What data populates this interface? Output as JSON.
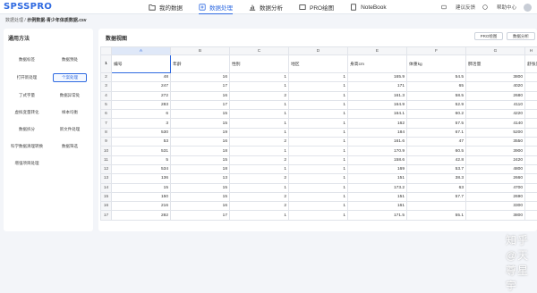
{
  "app": {
    "logo": "SPSSPRO"
  },
  "nav": [
    {
      "label": "我的数据",
      "icon": "folder-icon"
    },
    {
      "label": "数据处理",
      "icon": "data-process-icon",
      "active": true
    },
    {
      "label": "数据分析",
      "icon": "chart-icon"
    },
    {
      "label": "PRO绘图",
      "icon": "pro-draw-icon"
    },
    {
      "label": "NoteBook",
      "icon": "notebook-icon"
    }
  ],
  "top_right": {
    "feedback": "建议反馈",
    "help": "帮助中心"
  },
  "breadcrumb": {
    "root": "数据处理",
    "sep": " / ",
    "file": "示例数据-青少年体质数据.csv"
  },
  "left_panel": {
    "title": "通用方法",
    "methods": [
      "数据标签",
      "数据预处",
      "打开新处理",
      "个案处理",
      "丁式字量",
      "数据异常处",
      "虚拟变量转化",
      "样本均衡",
      "数据拆分",
      "新文件处理",
      "科学数据清理转换",
      "数据筛选",
      "增强项目处理"
    ]
  },
  "main": {
    "title": "数据视图",
    "btn_pro": "PRO绘图",
    "btn_analysis": "数据分析",
    "columns": [
      "A",
      "B",
      "C",
      "D",
      "E",
      "F",
      "G",
      "H"
    ],
    "header_row": [
      "编号",
      "年龄",
      "性别",
      "地区",
      "身高cm",
      "体重kg",
      "肺活量",
      "舒张压"
    ],
    "rows": [
      [
        "48",
        "16",
        "1",
        "1",
        "165.9",
        "54.5",
        "3800",
        ""
      ],
      [
        "247",
        "17",
        "1",
        "1",
        "171",
        "65",
        "4020",
        ""
      ],
      [
        "272",
        "16",
        "2",
        "1",
        "161.3",
        "58.5",
        "2680",
        ""
      ],
      [
        "283",
        "17",
        "1",
        "1",
        "164.9",
        "52.9",
        "4110",
        ""
      ],
      [
        "6",
        "15",
        "1",
        "1",
        "164.1",
        "60.2",
        "4220",
        ""
      ],
      [
        "3",
        "15",
        "1",
        "1",
        "162",
        "57.5",
        "4140",
        ""
      ],
      [
        "530",
        "19",
        "1",
        "1",
        "184",
        "67.1",
        "5200",
        ""
      ],
      [
        "53",
        "16",
        "2",
        "1",
        "161.6",
        "47",
        "3550",
        ""
      ],
      [
        "531",
        "18",
        "1",
        "1",
        "170.9",
        "60.5",
        "3900",
        ""
      ],
      [
        "5",
        "15",
        "2",
        "1",
        "158.6",
        "42.8",
        "2420",
        ""
      ],
      [
        "534",
        "18",
        "1",
        "1",
        "169",
        "53.7",
        "4800",
        ""
      ],
      [
        "136",
        "13",
        "2",
        "1",
        "151",
        "38.3",
        "2660",
        ""
      ],
      [
        "15",
        "15",
        "1",
        "1",
        "173.2",
        "63",
        "4700",
        ""
      ],
      [
        "150",
        "15",
        "2",
        "1",
        "151",
        "57.7",
        "2690",
        ""
      ],
      [
        "216",
        "16",
        "2",
        "1",
        "161",
        "",
        "3300",
        ""
      ],
      [
        "282",
        "17",
        "1",
        "1",
        "171.5",
        "55.1",
        "3800",
        ""
      ]
    ]
  },
  "watermark": "知乎 @天尊星宇"
}
